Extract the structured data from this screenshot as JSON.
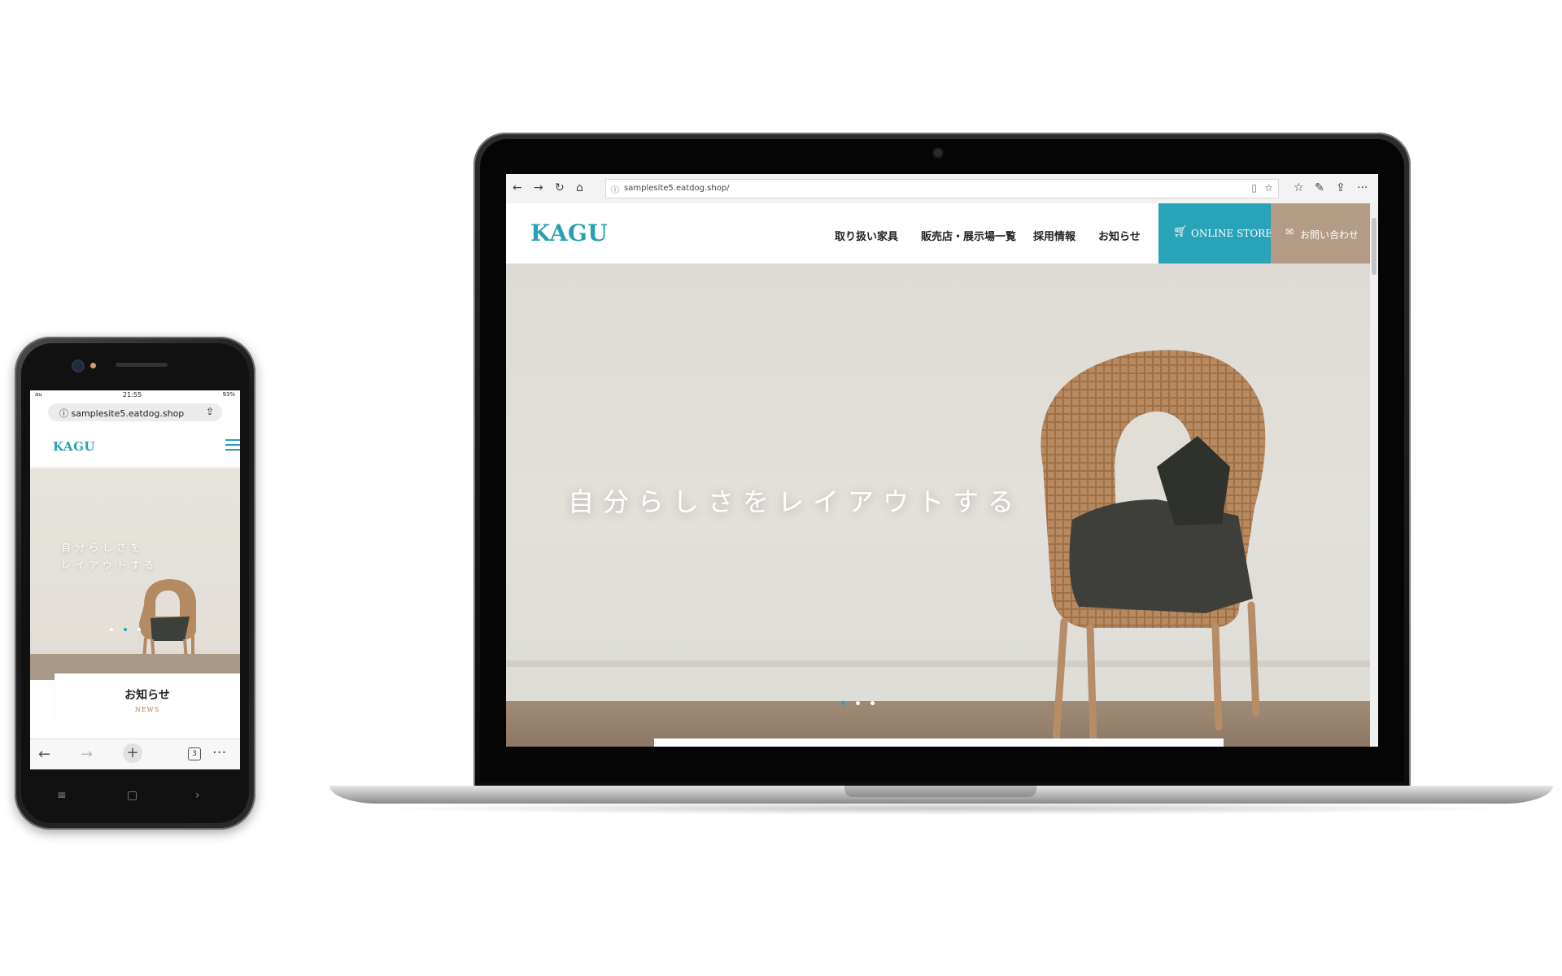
{
  "phone": {
    "status": {
      "time": "21:55",
      "left": "au",
      "right": "93%"
    },
    "url": "samplesite5.eatdog.shop",
    "logo": "KAGU",
    "hero_line1": "自分らしさを",
    "hero_line2": "レイアウトする",
    "news_title": "お知らせ",
    "news_sub": "NEWS",
    "tab_count": "3"
  },
  "browser": {
    "url": "samplesite5.eatdog.shop/"
  },
  "site": {
    "logo": "KAGU",
    "nav": [
      "取り扱い家具",
      "販売店・展示場一覧",
      "採用情報",
      "お知らせ"
    ],
    "store_label": "ONLINE STORE",
    "contact_label": "お問い合わせ",
    "hero_text": "自分らしさをレイアウトする"
  },
  "colors": {
    "accent": "#29a3b8",
    "contact": "#b39b85"
  },
  "icons": [
    "back-icon",
    "forward-icon",
    "refresh-icon",
    "home-icon",
    "info-icon",
    "bookmark-icon",
    "star-icon",
    "favorites-icon",
    "pen-icon",
    "share-icon",
    "more-icon",
    "cart-icon",
    "mail-icon",
    "hamburger-icon",
    "plus-icon",
    "tabs-icon"
  ]
}
